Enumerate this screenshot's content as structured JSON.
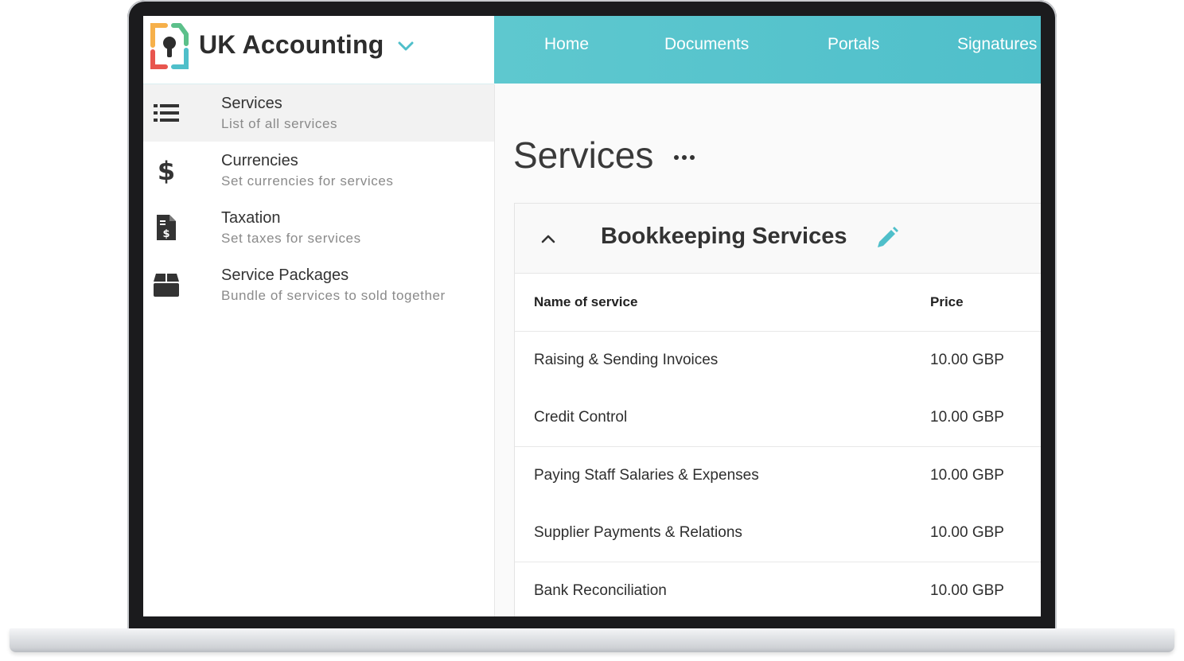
{
  "app": {
    "title": "UK Accounting"
  },
  "nav": {
    "items": [
      {
        "label": "Home"
      },
      {
        "label": "Documents"
      },
      {
        "label": "Portals"
      },
      {
        "label": "Signatures"
      }
    ]
  },
  "sidebar": {
    "items": [
      {
        "label": "Services",
        "sub": "List of all services",
        "icon": "list-icon",
        "active": true
      },
      {
        "label": "Currencies",
        "sub": "Set currencies for services",
        "icon": "dollar-icon"
      },
      {
        "label": "Taxation",
        "sub": "Set taxes for services",
        "icon": "tax-document-icon"
      },
      {
        "label": "Service Packages",
        "sub": "Bundle of services to sold together",
        "icon": "package-icon"
      }
    ]
  },
  "main": {
    "title": "Services",
    "card": {
      "title": "Bookkeeping Services",
      "columns": {
        "name": "Name of service",
        "price": "Price"
      },
      "rows": [
        {
          "name": "Raising & Sending Invoices",
          "price": "10.00 GBP"
        },
        {
          "name": "Credit Control",
          "price": "10.00 GBP"
        },
        {
          "name": "Paying Staff Salaries & Expenses",
          "price": "10.00 GBP"
        },
        {
          "name": "Supplier Payments & Relations",
          "price": "10.00 GBP"
        },
        {
          "name": "Bank Reconciliation",
          "price": "10.00 GBP"
        }
      ]
    }
  },
  "colors": {
    "accent": "#4fbfca",
    "text_dark": "#333333",
    "text_muted": "#8a8a8a",
    "logo_orange": "#f6b04a",
    "logo_green": "#5cc08a",
    "logo_red": "#e8554e",
    "logo_teal": "#4fbfca"
  }
}
